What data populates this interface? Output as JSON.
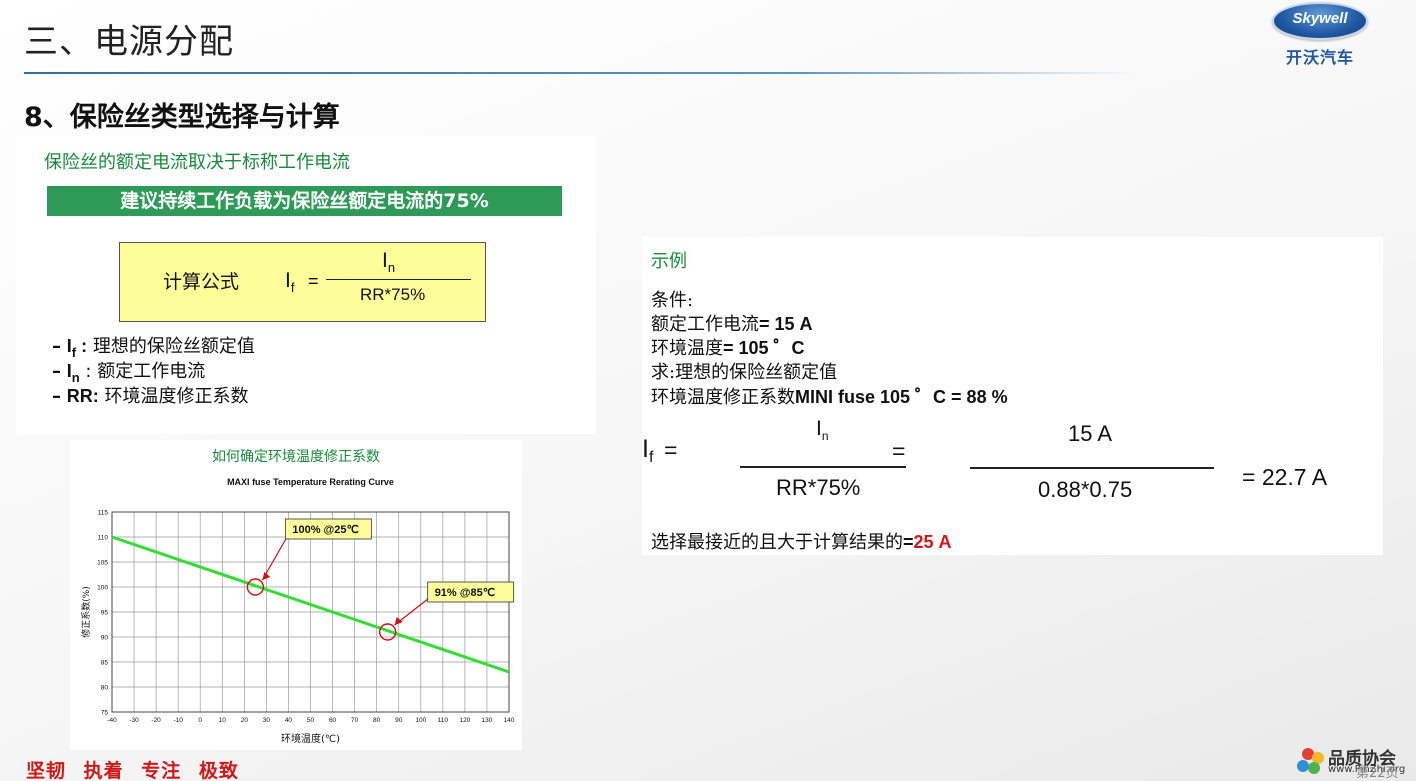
{
  "header": {
    "title": "三、电源分配",
    "logo_text": "Skywell",
    "logo_cn": "开沃汽车"
  },
  "section_heading": "8、保险丝类型选择与计算",
  "left_panel": {
    "heading": "保险丝的额定电流取决于标称工作电流",
    "banner": "建议持续工作负载为保险丝额定电流的75%",
    "formula": {
      "label": "计算公式",
      "lhs_var": "I",
      "lhs_sub": "f",
      "equals": "=",
      "num_var": "I",
      "num_sub": "n",
      "denominator": "RR*75%"
    },
    "definitions": [
      {
        "dash": "–",
        "var": "I",
        "sub": "f",
        "sep": " :",
        "text": " 理想的保险丝额定值"
      },
      {
        "dash": "–",
        "var": "I",
        "sub": "n",
        "sep": " :",
        "text": " 额定工作电流"
      },
      {
        "dash": "–",
        "var": "RR",
        "sub": "",
        "sep": ":",
        "text": " 环境温度修正系数"
      }
    ]
  },
  "chart_heading": "如何确定环境温度修正系数",
  "chart_data": {
    "type": "line",
    "title": "MAXI fuse Temperature Rerating Curve",
    "xlabel": "环境温度(℃)",
    "ylabel": "修正系数(%)",
    "xlim": [
      -40,
      140
    ],
    "ylim": [
      75,
      115
    ],
    "x_ticks": [
      -40,
      -30,
      -20,
      -10,
      0,
      10,
      20,
      30,
      40,
      50,
      60,
      70,
      80,
      90,
      100,
      110,
      120,
      130,
      140
    ],
    "y_ticks": [
      75,
      80,
      85,
      90,
      95,
      100,
      105,
      110,
      115
    ],
    "grid": true,
    "series": [
      {
        "x": [
          -40,
          140
        ],
        "y": [
          110,
          83
        ],
        "color": "#33dd33"
      }
    ],
    "annotations": [
      {
        "label": "100% @25℃",
        "x": 25,
        "y": 100
      },
      {
        "label": "91% @85℃",
        "x": 85,
        "y": 91
      }
    ]
  },
  "example": {
    "heading": "示例",
    "conditions_label": "条件:",
    "rated_current_label": "额定工作电流",
    "rated_current_value": "= 15 A",
    "ambient_label": "环境温度",
    "ambient_value": "= 105 ゜C",
    "find_label": "求:理想的保险丝额定值",
    "factor_label": "环境温度修正系数",
    "factor_value": "MINI fuse 105 ゜C = 88 %",
    "calc": {
      "lhs_var": "I",
      "lhs_sub": "f",
      "eq1": "=",
      "num1_var": "I",
      "num1_sub": "n",
      "den1": "RR*75%",
      "eq2": "=",
      "num2": "15 A",
      "den2": "0.88*0.75",
      "result": "= 22.7 A"
    },
    "conclusion_label": "选择最接近的且大于计算结果的",
    "conclusion_eq": "=",
    "conclusion_value": "25 A"
  },
  "footer": {
    "slogan": "坚韧 执着 专注 极致",
    "watermark_cn": "品质协会",
    "watermark_url": "www.PinZhi.org",
    "page_number": "第22页"
  }
}
